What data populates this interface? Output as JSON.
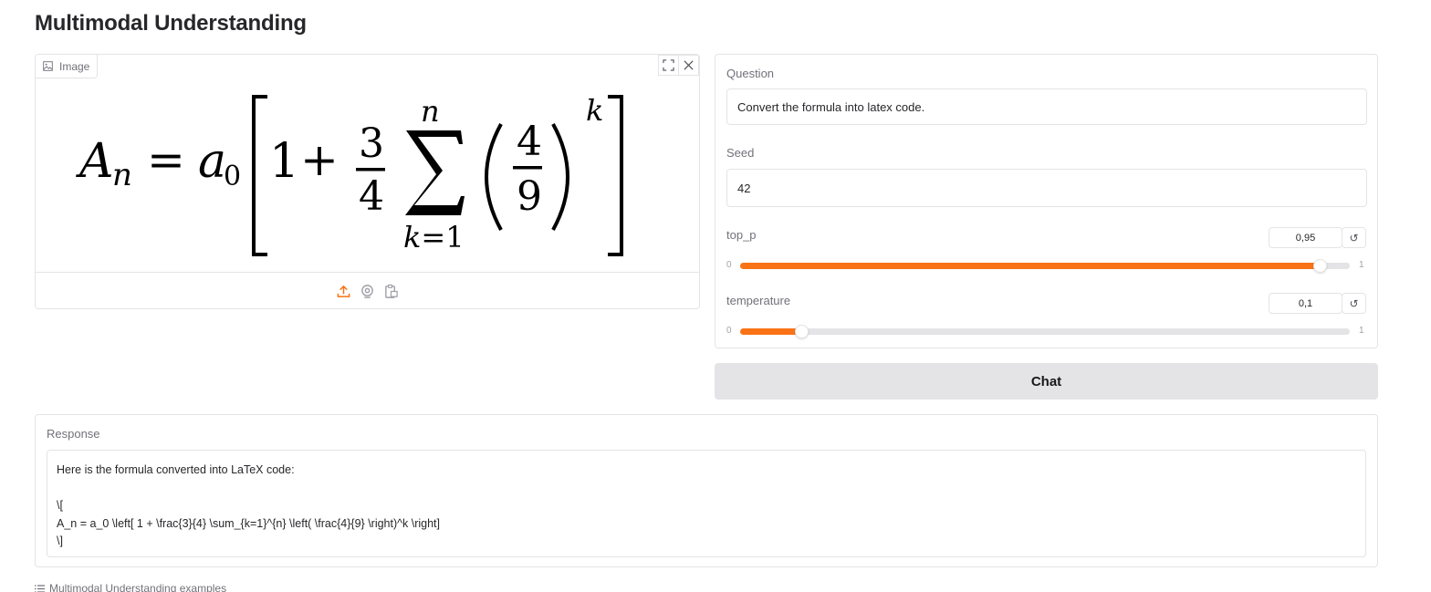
{
  "page_title": "Multimodal Understanding",
  "image_panel": {
    "label": "Image",
    "label_icon": "image-icon",
    "toolbar_icons": [
      "fullscreen-icon",
      "close-icon"
    ],
    "source_icons": [
      "upload-icon",
      "webcam-icon",
      "clipboard-icon"
    ],
    "accent_color": "#f97316"
  },
  "question": {
    "label": "Question",
    "value": "Convert the formula into latex code."
  },
  "seed": {
    "label": "Seed",
    "value": "42"
  },
  "top_p": {
    "label": "top_p",
    "value": "0,95",
    "min": "0",
    "max": "1",
    "fraction": 0.95,
    "reset_icon": "↺"
  },
  "temperature": {
    "label": "temperature",
    "value": "0,1",
    "min": "0",
    "max": "1",
    "fraction": 0.1,
    "reset_icon": "↺"
  },
  "chat_button": {
    "label": "Chat"
  },
  "response": {
    "label": "Response",
    "lines": [
      "Here is the formula converted into LaTeX code:",
      "",
      "\\[",
      "A_n = a_0 \\left[ 1 + \\frac{3}{4} \\sum_{k=1}^{n} \\left( \\frac{4}{9} \\right)^k \\right]",
      "\\]"
    ]
  },
  "examples": {
    "label": "Multimodal Understanding examples",
    "icon": "list-icon"
  },
  "colors": {
    "accent": "#f97316",
    "border": "#e4e4e7",
    "button_bg": "#e4e4e7"
  }
}
